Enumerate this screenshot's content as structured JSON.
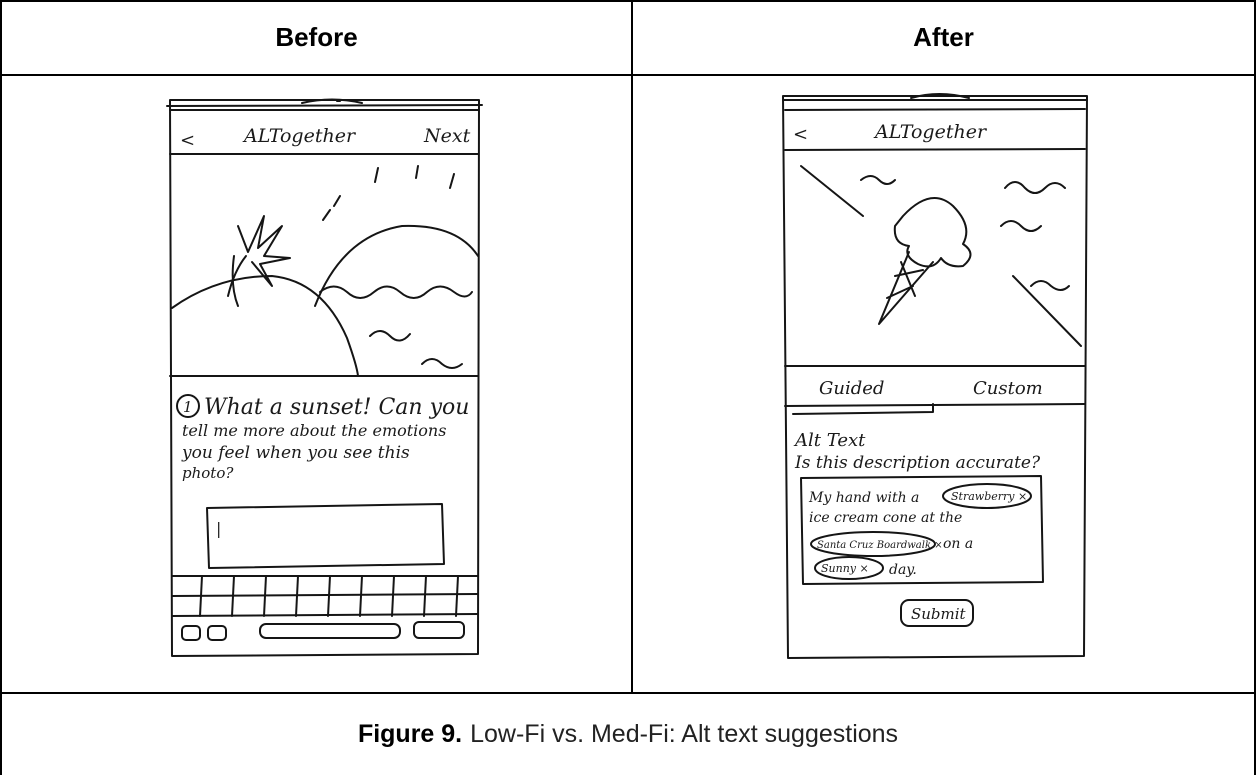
{
  "table": {
    "headers": [
      "Before",
      "After"
    ],
    "caption_label": "Figure 9.",
    "caption_text": "Low-Fi vs. Med-Fi: Alt text suggestions"
  },
  "before": {
    "back": "<",
    "app_title": "ALTogether",
    "next": "Next",
    "question_number": "1",
    "question_line1": "What a sunset! Can you",
    "question_line2": "tell me more about the emotions",
    "question_line3": "you feel when you see this",
    "question_line4": "photo?",
    "input_value": "|"
  },
  "after": {
    "back": "<",
    "app_title": "ALTogether",
    "tab_guided": "Guided",
    "tab_custom": "Custom",
    "alt_text_label": "Alt Text",
    "question": "Is this description accurate?",
    "desc_line1": "My hand with a",
    "chip_strawberry": "Strawberry ×",
    "desc_line2": "ice cream cone at the",
    "chip_santa_cruz": "Santa Cruz Boardwalk ×",
    "desc_line3": "on a",
    "chip_sunny": "Sunny ×",
    "desc_line4": "day.",
    "submit": "Submit"
  }
}
